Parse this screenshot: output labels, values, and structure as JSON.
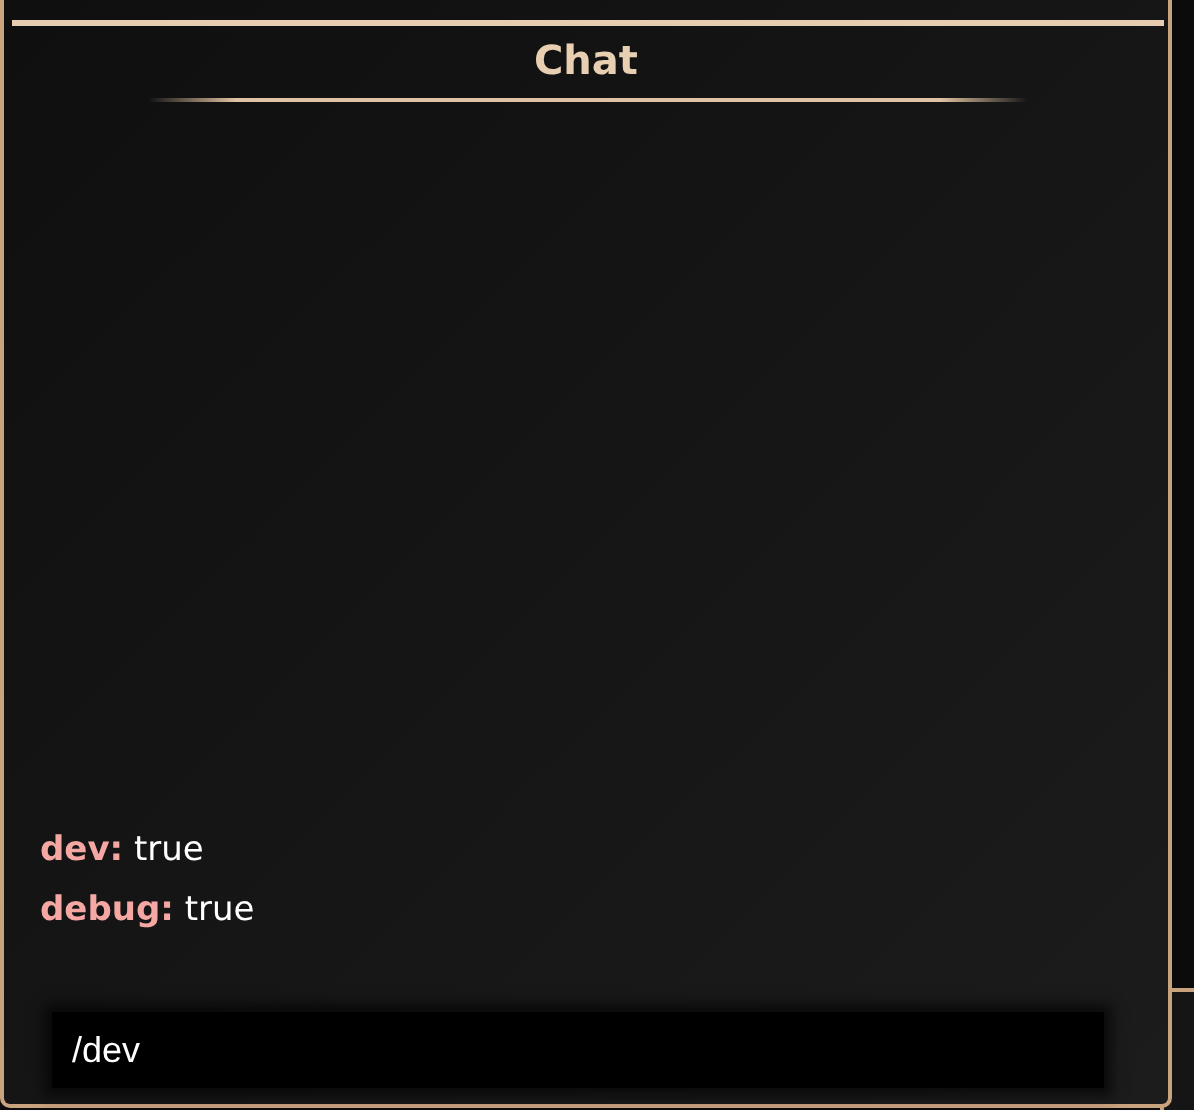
{
  "panel": {
    "title": "Chat"
  },
  "messages": [
    {
      "key": "dev:",
      "value": "true"
    },
    {
      "key": "debug:",
      "value": "true"
    }
  ],
  "input": {
    "value": "/dev"
  }
}
